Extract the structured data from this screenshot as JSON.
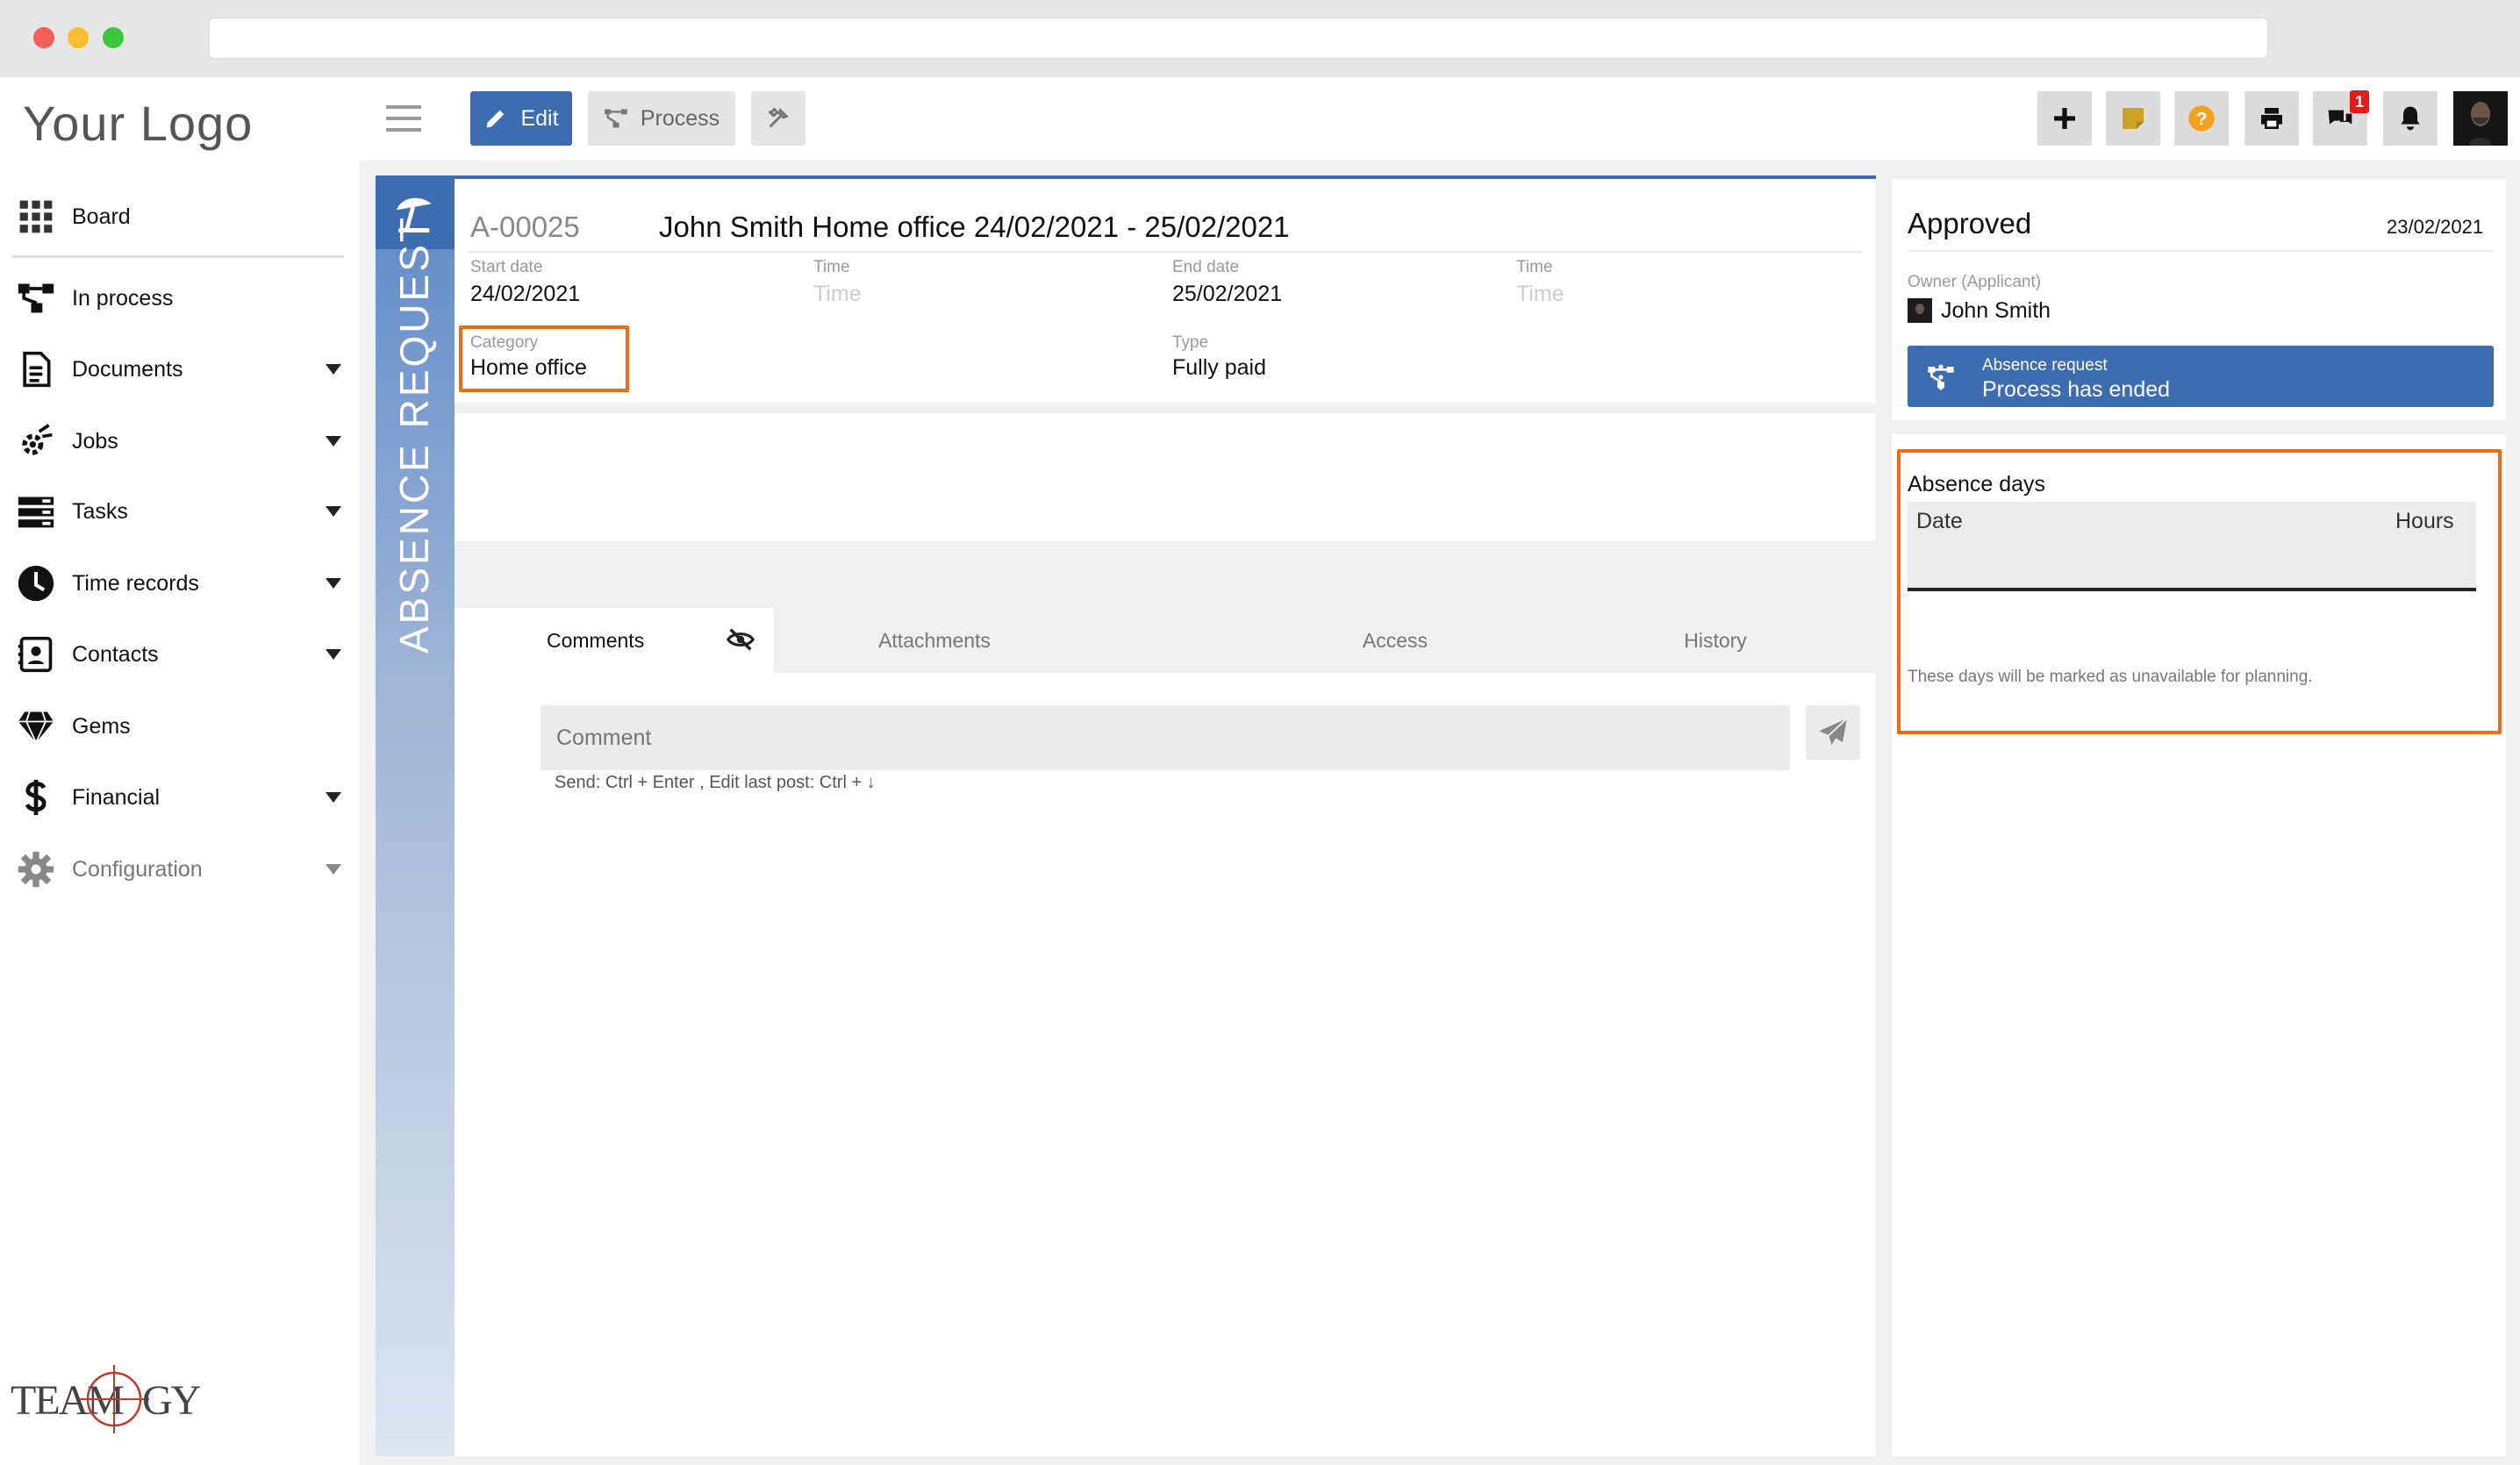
{
  "app": {
    "logo_text": "Your Logo",
    "brand": "TEAMOGY"
  },
  "colors": {
    "accent": "#3d6cb0",
    "highlight": "#f26a12",
    "badge": "#e31b1b"
  },
  "sidebar": {
    "items": [
      {
        "label": "Board",
        "icon": "grid-icon",
        "has_caret": false
      },
      {
        "label": "In process",
        "icon": "process-icon",
        "has_caret": false
      },
      {
        "label": "Documents",
        "icon": "document-icon",
        "has_caret": true
      },
      {
        "label": "Jobs",
        "icon": "jobs-icon",
        "has_caret": true
      },
      {
        "label": "Tasks",
        "icon": "tasks-icon",
        "has_caret": true
      },
      {
        "label": "Time records",
        "icon": "clock-icon",
        "has_caret": true
      },
      {
        "label": "Contacts",
        "icon": "contacts-icon",
        "has_caret": true
      },
      {
        "label": "Gems",
        "icon": "gem-icon",
        "has_caret": false
      },
      {
        "label": "Financial",
        "icon": "dollar-icon",
        "has_caret": true
      },
      {
        "label": "Configuration",
        "icon": "gear-icon",
        "has_caret": true
      }
    ]
  },
  "toolbar": {
    "edit_label": "Edit",
    "process_label": "Process",
    "notification_count": "1"
  },
  "document": {
    "type_label": "ABSENCE REQUEST",
    "id": "A-00025",
    "title": "John Smith Home office 24/02/2021 - 25/02/2021",
    "fields": {
      "start_date_label": "Start date",
      "start_date": "24/02/2021",
      "time1_label": "Time",
      "time1_placeholder": "Time",
      "end_date_label": "End date",
      "end_date": "25/02/2021",
      "time2_label": "Time",
      "time2_placeholder": "Time",
      "category_label": "Category",
      "category": "Home office",
      "type_label": "Type",
      "type": "Fully paid"
    }
  },
  "tabs": [
    "Comments",
    "Attachments",
    "Access",
    "History"
  ],
  "comment": {
    "placeholder": "Comment",
    "hint": "Send: Ctrl + Enter , Edit last post: Ctrl + ↓"
  },
  "status_panel": {
    "status": "Approved",
    "date": "23/02/2021",
    "owner_label": "Owner (Applicant)",
    "owner_name": "John Smith",
    "process_title": "Absence request",
    "process_status": "Process has ended"
  },
  "absence_days": {
    "title": "Absence days",
    "col_date": "Date",
    "col_hours": "Hours",
    "note": "These days will be marked as unavailable for planning."
  }
}
